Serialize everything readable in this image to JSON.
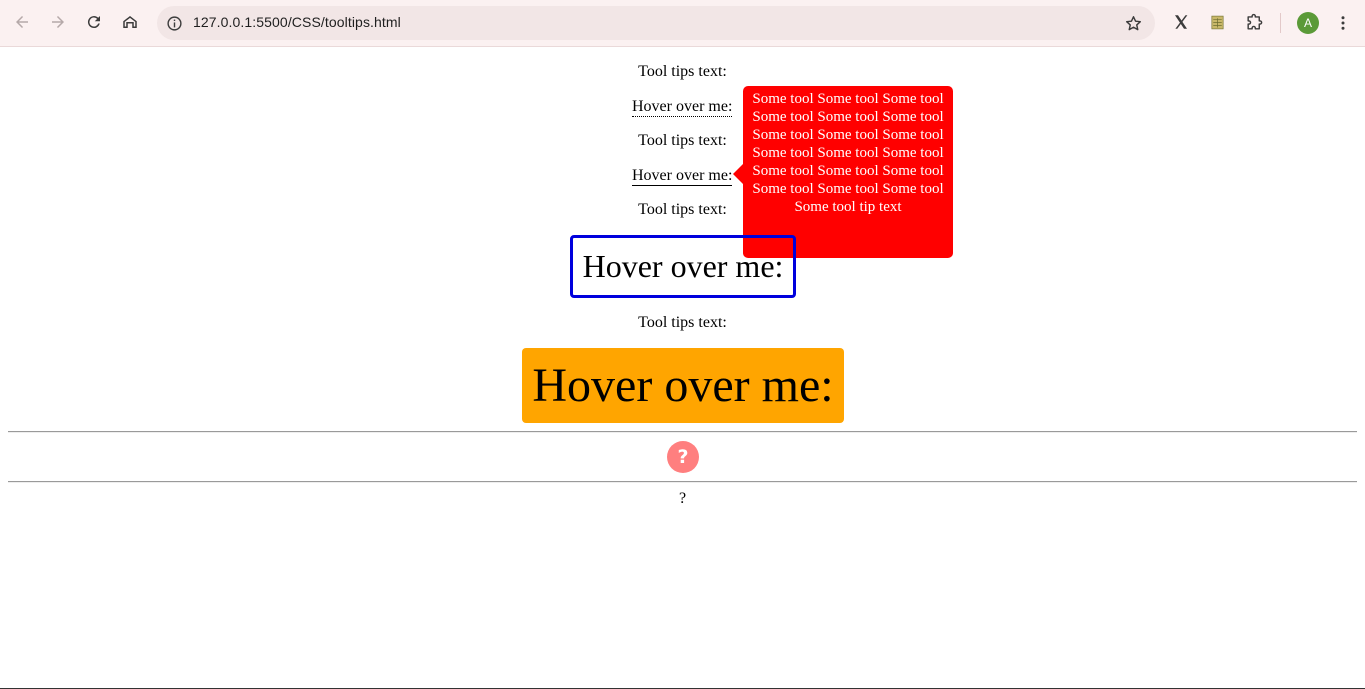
{
  "browser": {
    "url": "127.0.0.1:5500/CSS/tooltips.html",
    "avatar_letter": "A",
    "icons": {
      "back": "arrow-left-icon",
      "forward": "arrow-right-icon",
      "reload": "reload-icon",
      "home": "home-icon",
      "site_info": "info-icon",
      "bookmark": "star-icon",
      "extension_x": "x-logo-icon",
      "extension_sheets": "spreadsheet-icon",
      "extensions": "puzzle-icon",
      "menu": "kebab-menu-icon"
    },
    "avatar_color": "#5b9a38"
  },
  "content": {
    "label_1": "Tool tips text:",
    "hover_1": "Hover over me:",
    "label_2": "Tool tips text:",
    "hover_2": "Hover over me:",
    "tooltip_text": "Some tool Some tool Some tool Some tool Some tool Some tool Some tool Some tool Some tool Some tool Some tool Some tool Some tool Some tool Some tool Some tool Some tool Some tool Some tool tip text",
    "label_3": "Tool tips text:",
    "hover_3": "Hover over me:",
    "label_4": "Tool tips text:",
    "hover_4": "Hover over me:",
    "help_icon_glyph": "?",
    "question_text": "?"
  },
  "colors": {
    "tooltip_bg": "#ff0000",
    "blue_border": "#0000dd",
    "orange_bg": "#ffa500",
    "help_circle": "#ff7f7f"
  }
}
